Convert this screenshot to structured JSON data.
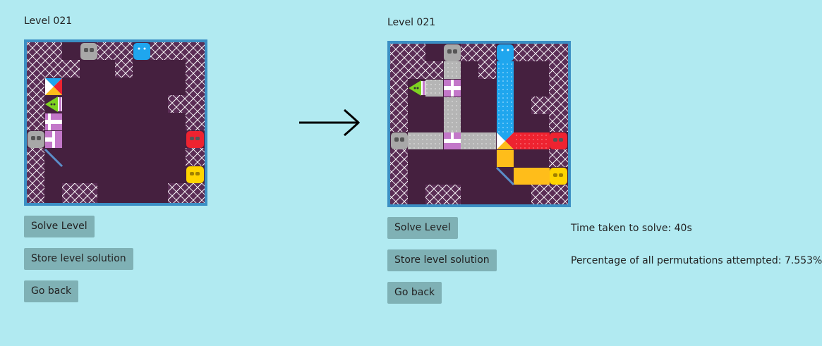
{
  "left_panel": {
    "title": "Level 021",
    "buttons": {
      "solve": "Solve Level",
      "store": "Store level solution",
      "back": "Go back"
    }
  },
  "right_panel": {
    "title": "Level 021",
    "buttons": {
      "solve": "Solve Level",
      "store": "Store level solution",
      "back": "Go back"
    },
    "time_taken": "Time taken to solve: 40s",
    "percentage": "Percentage of all permutations attempted: 7.553%"
  },
  "colors": {
    "background": "#b1eaf1",
    "board_border": "#3b8fc4",
    "board_floor": "#45203f",
    "wall_bg": "#5a2d55",
    "wall_pattern": "#ffffff",
    "button_bg": "#7fb1b5",
    "grey_block": "#a8a8a8",
    "blue_block": "#1fa6ee",
    "red_block": "#ee2330",
    "yellow_block": "#ffd400",
    "orange_pipe": "#ffbd1a",
    "green_triangle": "#7ed321",
    "purple_connector": "#c377c9"
  }
}
